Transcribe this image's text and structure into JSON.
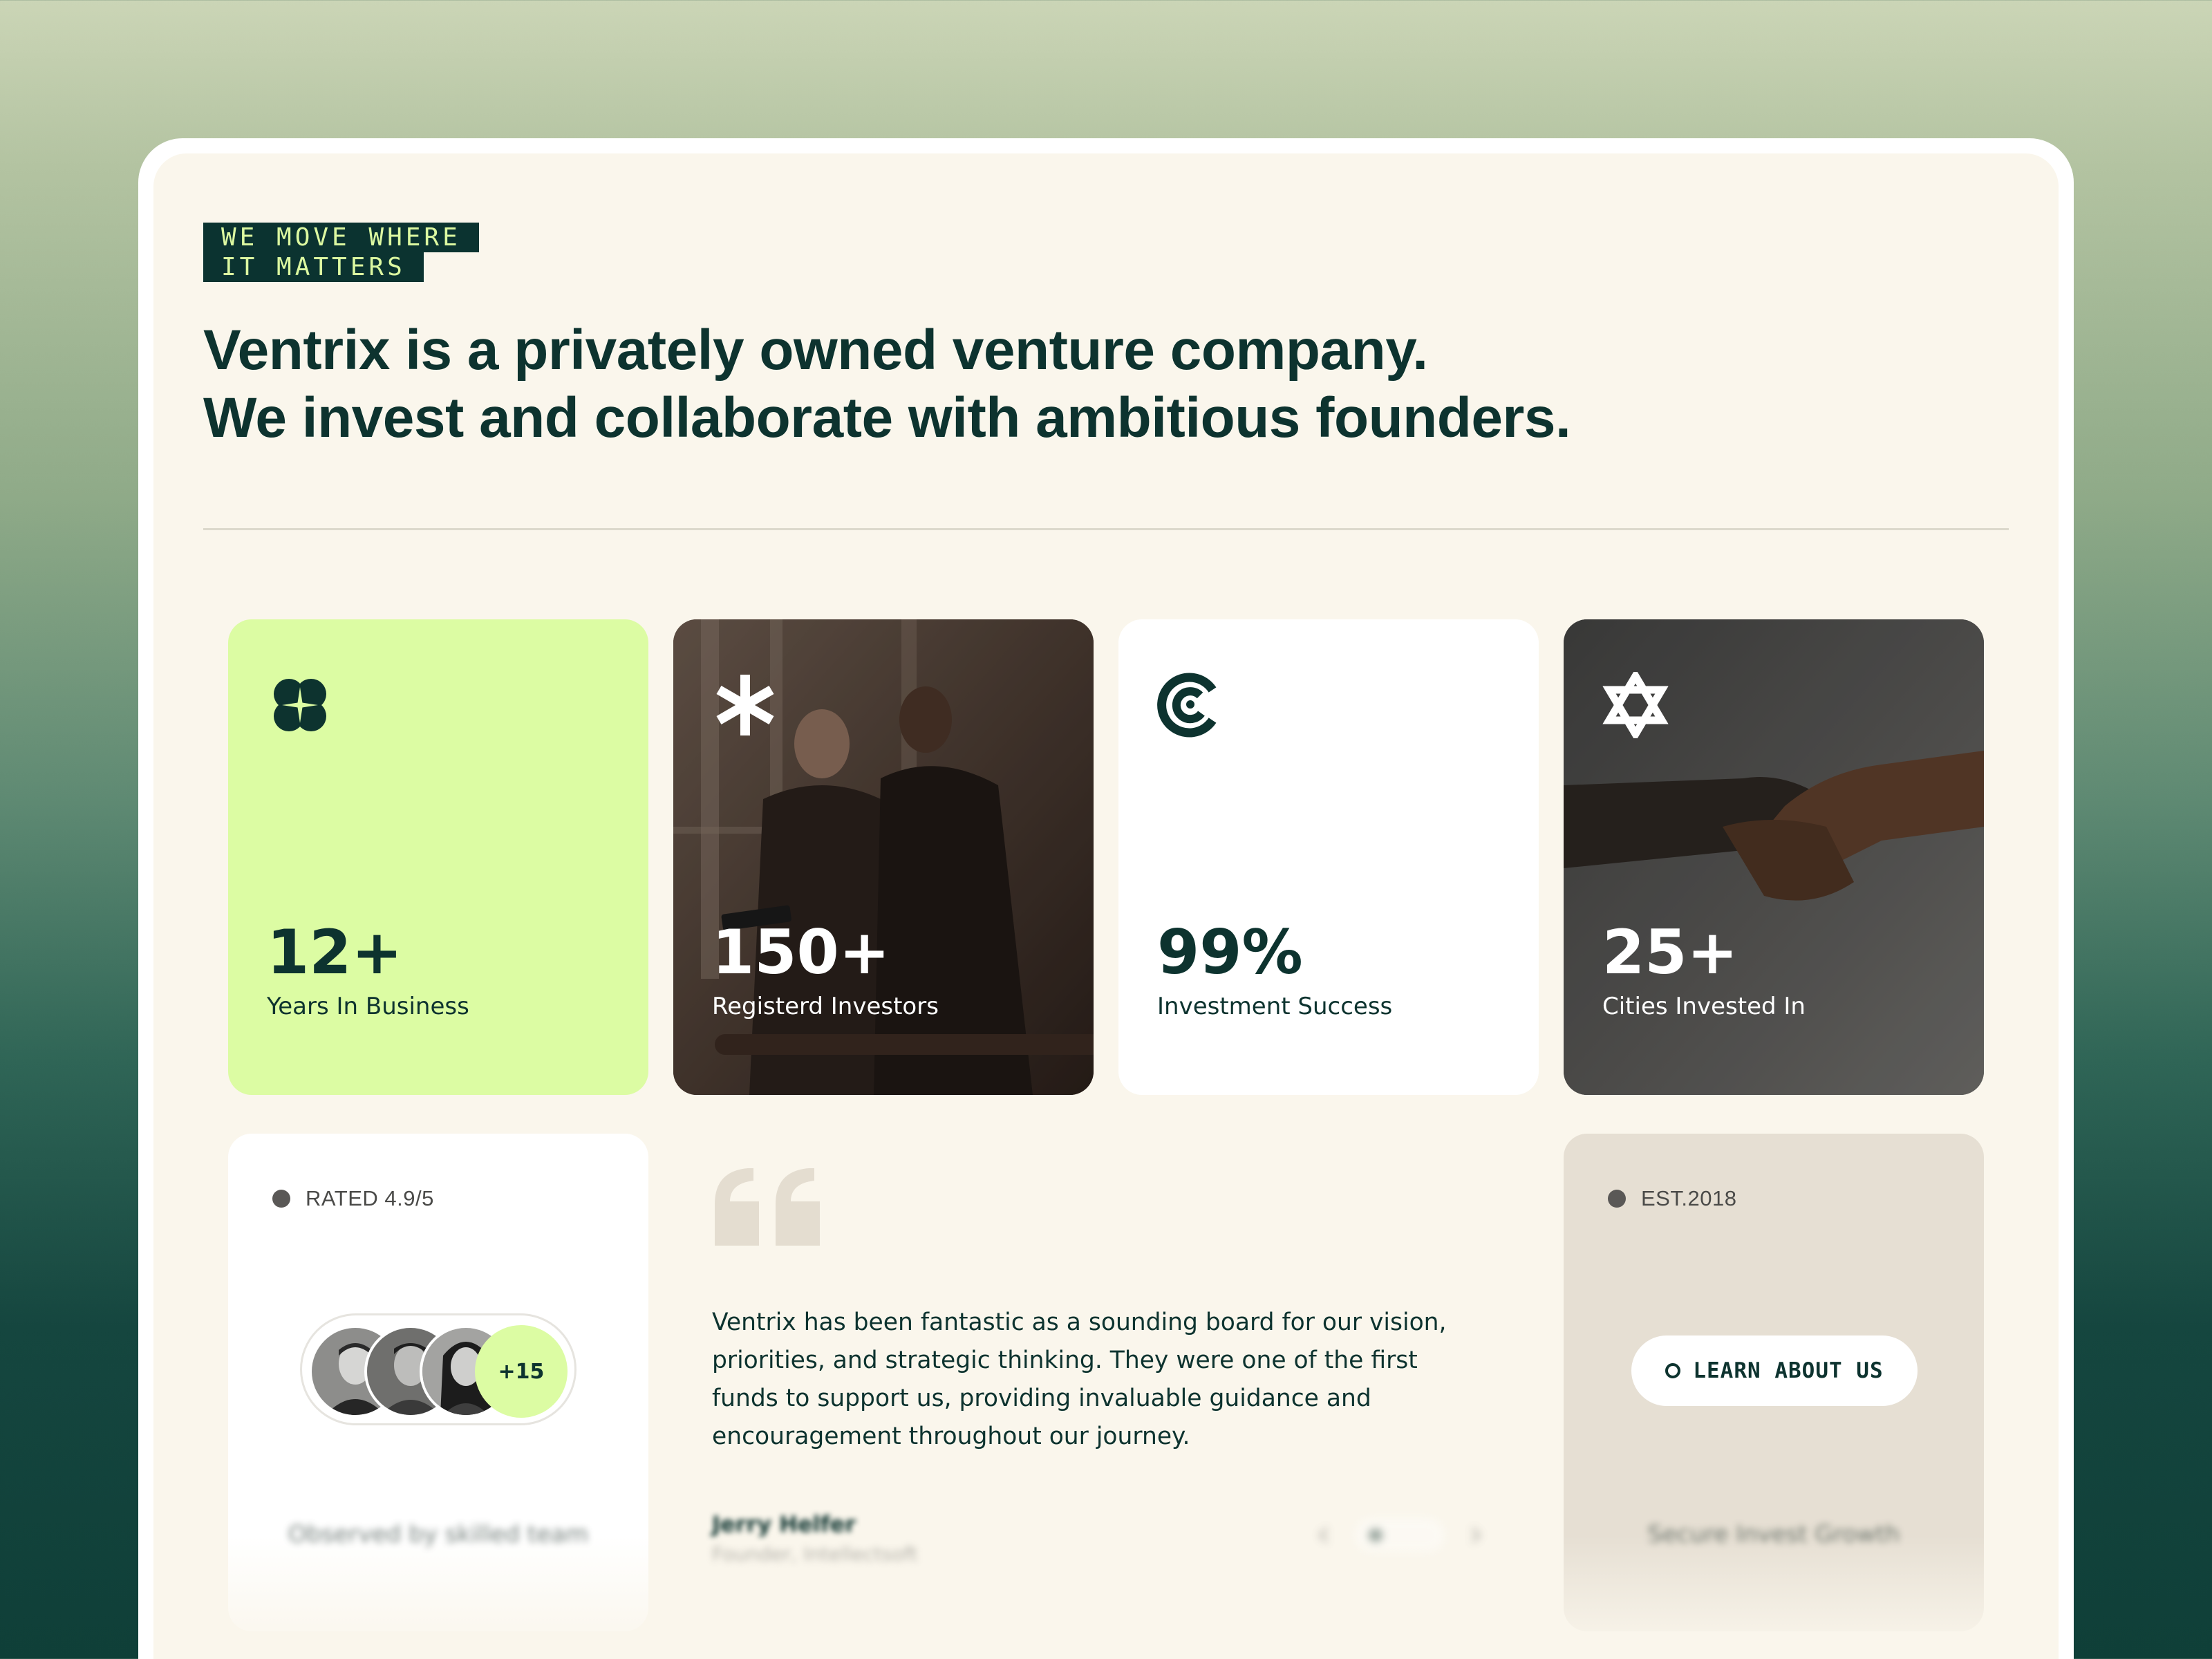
{
  "tag": {
    "line1": "WE MOVE WHERE",
    "line2": "IT MATTERS"
  },
  "headline": {
    "line1": "Ventrix is a privately owned venture company.",
    "line2": "We invest and collaborate with ambitious founders."
  },
  "stats": [
    {
      "value": "12+",
      "label": "Years In Business",
      "icon": "clover-icon"
    },
    {
      "value": "150+",
      "label": "Registerd Investors",
      "icon": "asterisk-icon"
    },
    {
      "value": "99%",
      "label": "Investment Success",
      "icon": "spiral-icon"
    },
    {
      "value": "25+",
      "label": "Cities Invested In",
      "icon": "star-of-david-icon"
    }
  ],
  "rating": {
    "badge": "RATED 4.9/5",
    "more_count": "+15",
    "caption": "Observed by skilled team"
  },
  "testimonial": {
    "quote": "Ventrix has been fantastic as a sounding board for our vision, priorities, and strategic thinking. They were one of the first funds to support us, providing invaluable guidance and encouragement throughout our journey.",
    "author_name": "Jerry Helfer",
    "author_role": "Founder, Intellectsoft"
  },
  "about": {
    "badge": "EST.2018",
    "button_label": "LEARN ABOUT US",
    "caption": "Secure Invest Growth"
  },
  "colors": {
    "dark_green": "#0d332f",
    "lime": "#dcfca3",
    "cream": "#faf6ec",
    "beige": "#e6dfd3"
  }
}
